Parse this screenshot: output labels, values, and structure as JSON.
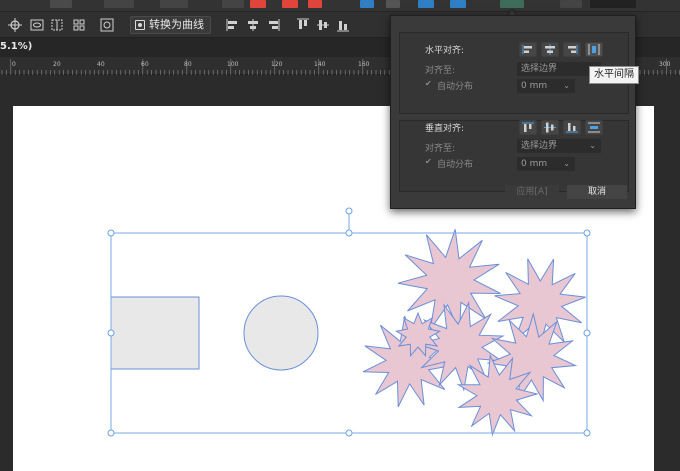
{
  "document": {
    "zoom_label": "5.1%)"
  },
  "context_toolbar": {
    "convert_label": "转换为曲线"
  },
  "ruler": {
    "ticks": [
      "0",
      "20",
      "40",
      "60",
      "80",
      "100",
      "120",
      "140",
      "160",
      "300"
    ]
  },
  "align_panel": {
    "horizontal_label": "水平对齐:",
    "h_align_to_label": "对齐至:",
    "h_align_to_value": "选择边界",
    "h_auto_distribute": "自动分布",
    "h_spacing_value": "0 mm",
    "vertical_label": "垂直对齐:",
    "v_align_to_label": "对齐至:",
    "v_align_to_value": "选择边界",
    "v_auto_distribute": "自动分布",
    "v_spacing_value": "0 mm",
    "apply_label": "应用[A]",
    "cancel_label": "取消",
    "tooltip": "水平间隔"
  },
  "colors": {
    "selection": "#6aa0e8",
    "star_fill": "#e8c6d2",
    "star_stroke": "#6a8fd8",
    "shape_fill": "#e8e8e8"
  }
}
